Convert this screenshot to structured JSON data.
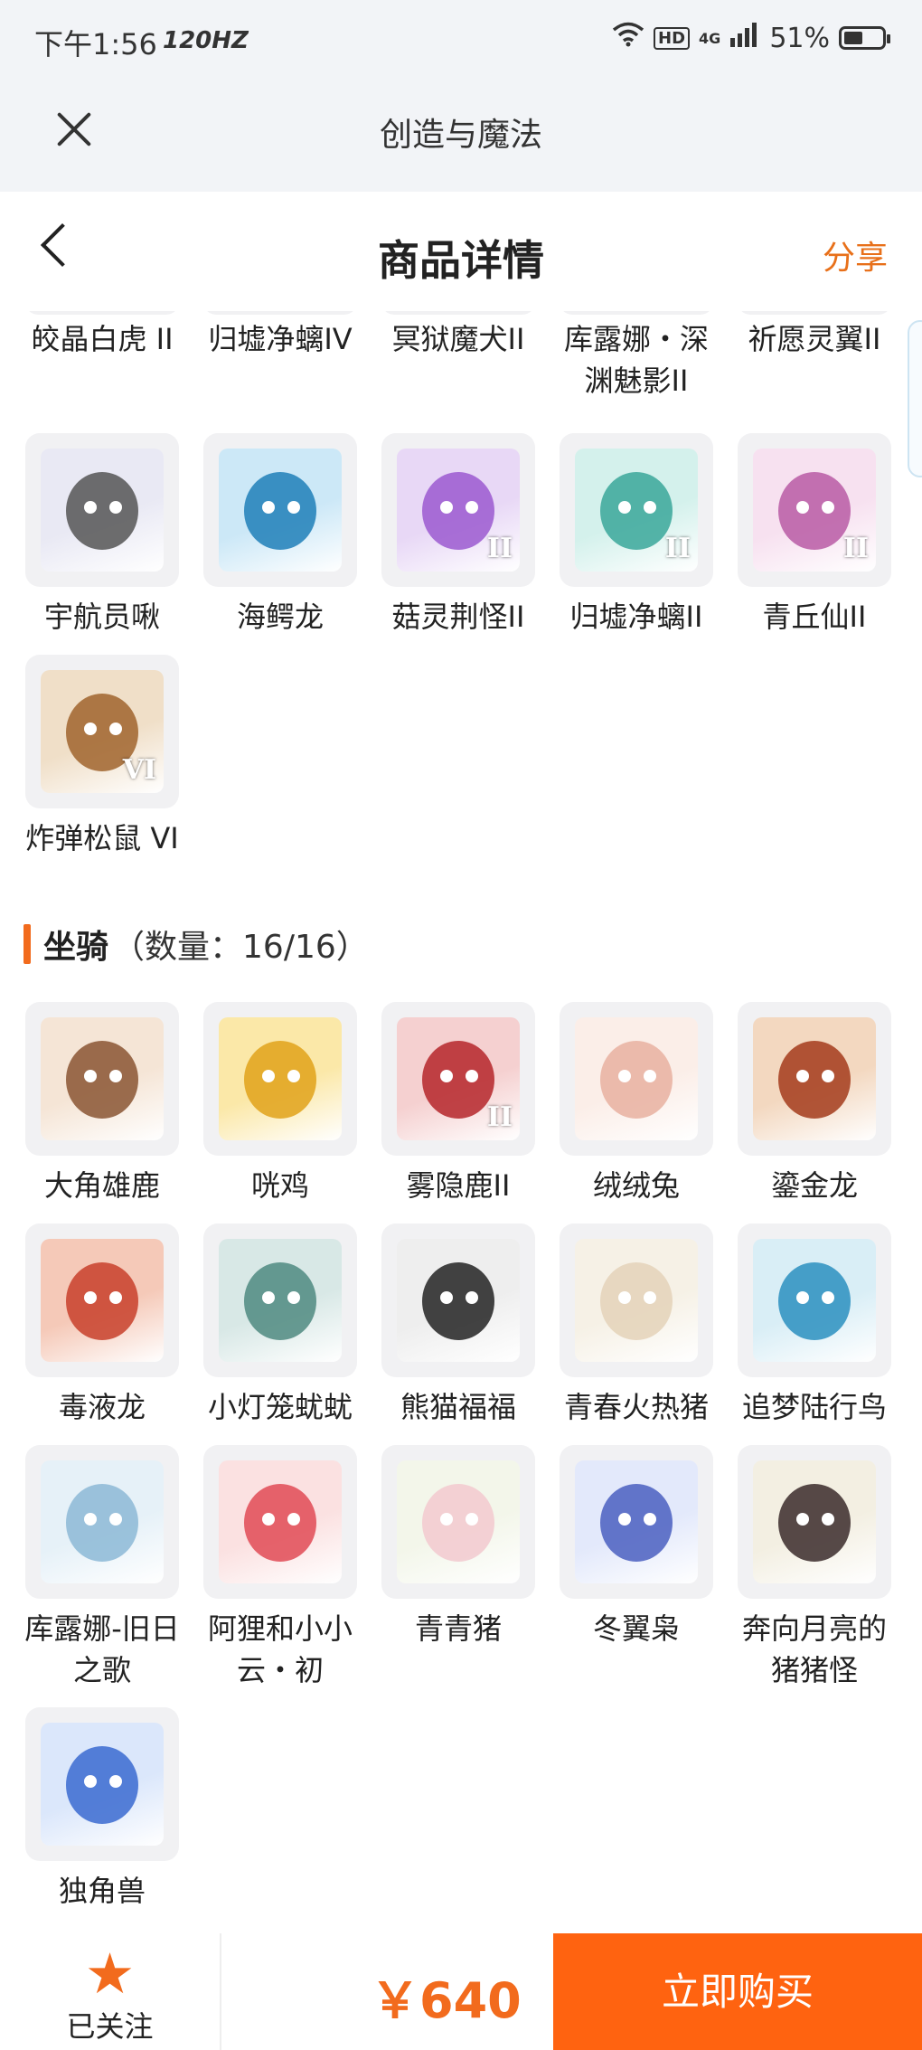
{
  "status_bar": {
    "time": "下午1:56",
    "refresh": "120HZ",
    "hd": "HD",
    "network": "4G",
    "battery": "51%",
    "battery_level": 0.51
  },
  "app_header": {
    "title": "创造与魔法"
  },
  "nav": {
    "title": "商品详情",
    "share": "分享"
  },
  "pets_partial": [
    {
      "name": "皎晶白虎 II"
    },
    {
      "name": "归墟净螭IV"
    },
    {
      "name": "冥狱魔犬II"
    },
    {
      "name": "库露娜・深渊魅影II"
    },
    {
      "name": "祈愿灵翼II"
    },
    {
      "name": "宇航员啾"
    },
    {
      "name": "海鳄龙"
    },
    {
      "name": "菇灵荆怪II",
      "badge": "II"
    },
    {
      "name": "归墟净螭II",
      "badge": "II"
    },
    {
      "name": "青丘仙II",
      "badge": "II"
    },
    {
      "name": "炸弹松鼠 VI",
      "badge": "VI"
    }
  ],
  "mounts_section": {
    "title": "坐骑",
    "count": "（数量：16/16）"
  },
  "mounts": [
    {
      "name": "大角雄鹿"
    },
    {
      "name": "咣鸡"
    },
    {
      "name": "雾隐鹿II",
      "badge": "II"
    },
    {
      "name": "绒绒兔"
    },
    {
      "name": "鎏金龙"
    },
    {
      "name": "毒液龙"
    },
    {
      "name": "小灯笼蚘蚘"
    },
    {
      "name": "熊猫福福"
    },
    {
      "name": "青春火热猪"
    },
    {
      "name": "追梦陆行鸟"
    },
    {
      "name": "库露娜-旧日之歌"
    },
    {
      "name": "阿狸和小小云・初"
    },
    {
      "name": "青青猪"
    },
    {
      "name": "冬翼枭"
    },
    {
      "name": "奔向月亮的猪猪怪"
    },
    {
      "name": "独角兽"
    }
  ],
  "footer": {
    "follow_label": "已关注",
    "price": "￥640",
    "buy_label": "立即购买"
  },
  "colors": {
    "accent": "#f26b1d",
    "buy_button": "#ff6310",
    "header_bg": "#f2f4f7"
  }
}
